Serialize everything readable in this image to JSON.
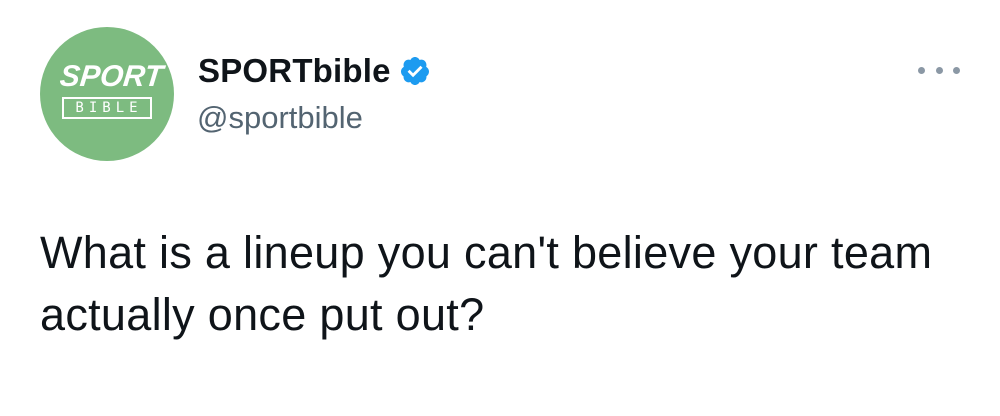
{
  "tweet": {
    "author": {
      "display_name": "SPORTbible",
      "handle": "@sportbible",
      "verified": true,
      "avatar_logo_top": "SPORT",
      "avatar_logo_bottom": "BIBLE",
      "avatar_bg_color": "#7dbb80"
    },
    "text": "What is a lineup you can't believe your team actually once put out?",
    "more_icon": "more-horizontal-icon",
    "verified_icon": "verified-badge-icon",
    "accent_color": "#1d9bf0"
  }
}
